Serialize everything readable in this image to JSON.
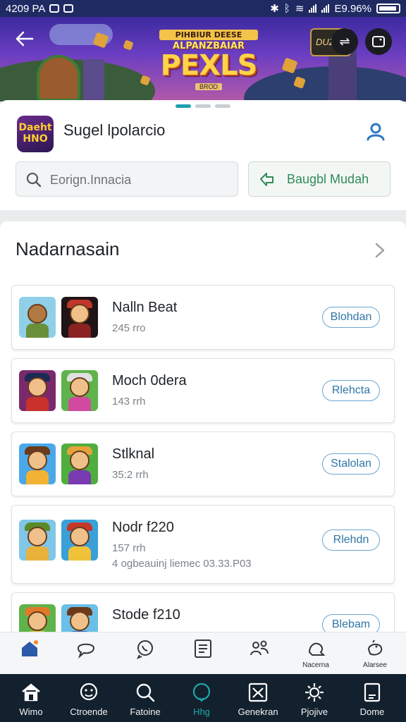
{
  "status_bar": {
    "time": "4209 PA",
    "battery": "E9.96%"
  },
  "banner": {
    "title_top": "PIHBIUR DEESE",
    "title_mid": "ALPANZBAIAR",
    "title_main": "PEXLS",
    "title_sub": "BROD",
    "badge": "DUZ"
  },
  "app": {
    "icon_text": "Daeht HNO",
    "name": "Sugel lpolarcio"
  },
  "search": {
    "placeholder": "Eorign.Innacia"
  },
  "quick_action": {
    "label": "Baugbl Mudah"
  },
  "section": {
    "title": "Nadarnasain"
  },
  "items": [
    {
      "title": "Nalln Beat",
      "meta": "245 rro",
      "meta2": "",
      "button": "Blohdan"
    },
    {
      "title": "Moch 0dera",
      "meta": "143 rrh",
      "meta2": "",
      "button": "Rlehcta"
    },
    {
      "title": "Stlknal",
      "meta": "35:2 rrh",
      "meta2": "",
      "button": "Stalolan"
    },
    {
      "title": "Nodr f220",
      "meta": "157 rrh",
      "meta2": "4 ogbeauinj liemec 03.33.P03",
      "button": "Rlehdn"
    },
    {
      "title": "Stode f210",
      "meta": "",
      "meta2": "",
      "button": "Blebam"
    }
  ],
  "tab_row": {
    "tabs": [
      {
        "icon": "home-icon",
        "label": ""
      },
      {
        "icon": "chat-bubble-icon",
        "label": ""
      },
      {
        "icon": "whatsapp-icon",
        "label": ""
      },
      {
        "icon": "list-icon",
        "label": ""
      },
      {
        "icon": "people-icon",
        "label": ""
      },
      {
        "icon": "puzzle-icon",
        "label": "Nacerna"
      },
      {
        "icon": "bird-icon",
        "label": "Alarsee"
      }
    ]
  },
  "bottom_nav": {
    "items": [
      {
        "icon": "house-icon",
        "label": "Wimo"
      },
      {
        "icon": "smile-icon",
        "label": "Ctroende"
      },
      {
        "icon": "search-icon",
        "label": "Fatoine"
      },
      {
        "icon": "circle-icon",
        "label": "Hhg"
      },
      {
        "icon": "image-icon",
        "label": "Genekran"
      },
      {
        "icon": "settings-icon",
        "label": "Pjojive"
      },
      {
        "icon": "document-icon",
        "label": "Dome"
      }
    ]
  },
  "colors": {
    "accent_teal": "#1ea0b0",
    "green": "#2f8a56",
    "blue_outline": "#2f76a6",
    "nav_bg": "#13202e"
  }
}
